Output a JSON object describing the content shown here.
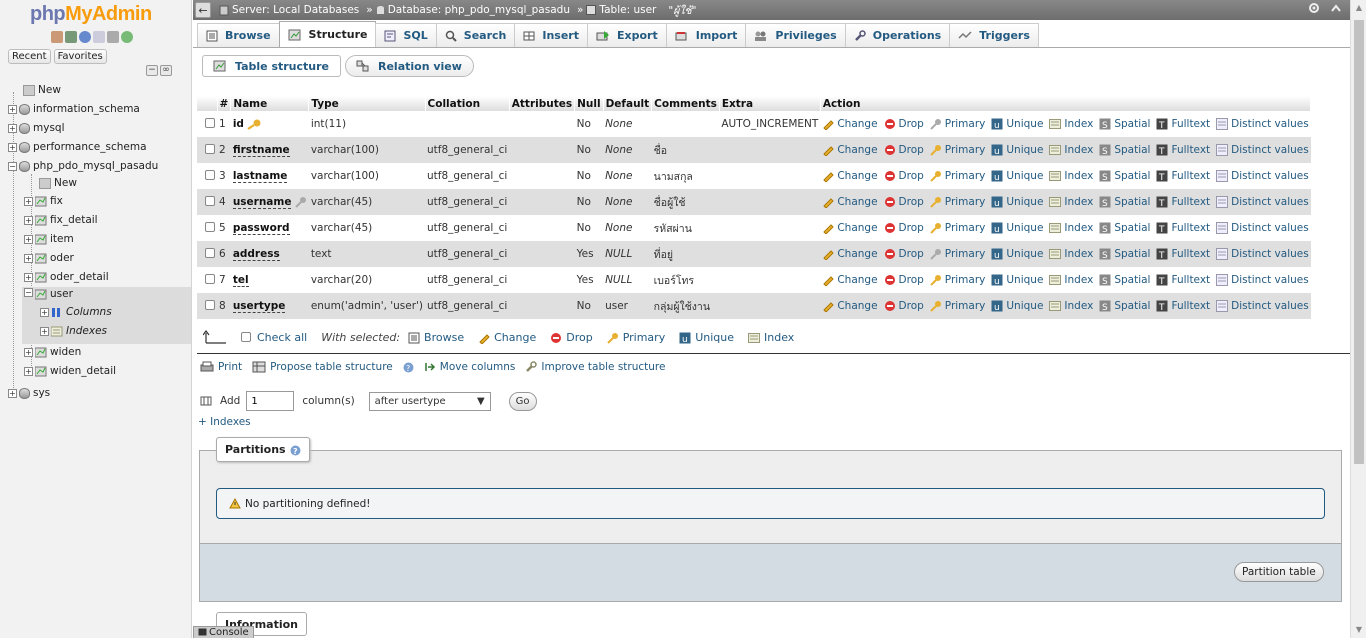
{
  "sidebar": {
    "logo_a": "php",
    "logo_b": "MyAdmin",
    "tabs": [
      "Recent",
      "Favorites"
    ],
    "tree": {
      "new": "New",
      "dbs": [
        {
          "label": "information_schema"
        },
        {
          "label": "mysql"
        },
        {
          "label": "performance_schema"
        },
        {
          "label": "php_pdo_mysql_pasadu"
        },
        {
          "label": "sys"
        }
      ],
      "db_new": "New",
      "tables": [
        "fix",
        "fix_detail",
        "item",
        "oder",
        "oder_detail",
        "user",
        "widen",
        "widen_detail"
      ],
      "user_children": [
        "Columns",
        "Indexes"
      ]
    }
  },
  "topbar": {
    "server": "Server: Local Databases",
    "database": "Database: php_pdo_mysql_pasadu",
    "table": "Table: user",
    "comment": "\"ผู้ใช้\""
  },
  "menu": [
    "Browse",
    "Structure",
    "SQL",
    "Search",
    "Insert",
    "Export",
    "Import",
    "Privileges",
    "Operations",
    "Triggers"
  ],
  "subtabs": [
    "Table structure",
    "Relation view"
  ],
  "table": {
    "headers": [
      "#",
      "Name",
      "Type",
      "Collation",
      "Attributes",
      "Null",
      "Default",
      "Comments",
      "Extra",
      "Action"
    ],
    "rows": [
      {
        "n": "1",
        "name": "id",
        "type": "int(11)",
        "coll": "",
        "attr": "",
        "null": "No",
        "def": "None",
        "com": "",
        "extra": "AUTO_INCREMENT"
      },
      {
        "n": "2",
        "name": "firstname",
        "type": "varchar(100)",
        "coll": "utf8_general_ci",
        "attr": "",
        "null": "No",
        "def": "None",
        "com": "ชื่อ",
        "extra": ""
      },
      {
        "n": "3",
        "name": "lastname",
        "type": "varchar(100)",
        "coll": "utf8_general_ci",
        "attr": "",
        "null": "No",
        "def": "None",
        "com": "นามสกุล",
        "extra": ""
      },
      {
        "n": "4",
        "name": "username",
        "type": "varchar(45)",
        "coll": "utf8_general_ci",
        "attr": "",
        "null": "No",
        "def": "None",
        "com": "ชื่อผู้ใช้",
        "extra": ""
      },
      {
        "n": "5",
        "name": "password",
        "type": "varchar(45)",
        "coll": "utf8_general_ci",
        "attr": "",
        "null": "No",
        "def": "None",
        "com": "รหัสผ่าน",
        "extra": ""
      },
      {
        "n": "6",
        "name": "address",
        "type": "text",
        "coll": "utf8_general_ci",
        "attr": "",
        "null": "Yes",
        "def": "NULL",
        "com": "ที่อยู่",
        "extra": ""
      },
      {
        "n": "7",
        "name": "tel",
        "type": "varchar(20)",
        "coll": "utf8_general_ci",
        "attr": "",
        "null": "Yes",
        "def": "NULL",
        "com": "เบอร์โทร",
        "extra": ""
      },
      {
        "n": "8",
        "name": "usertype",
        "type": "enum('admin', 'user')",
        "coll": "utf8_general_ci",
        "attr": "",
        "null": "No",
        "def": "user",
        "com": "กลุ่มผู้ใช้งาน",
        "extra": ""
      }
    ],
    "actions": [
      "Change",
      "Drop",
      "Primary",
      "Unique",
      "Index",
      "Spatial",
      "Fulltext",
      "Distinct values"
    ]
  },
  "with_selected": {
    "check_all": "Check all",
    "label": "With selected:",
    "actions": [
      "Browse",
      "Change",
      "Drop",
      "Primary",
      "Unique",
      "Index"
    ]
  },
  "tools": [
    "Print",
    "Propose table structure",
    "Move columns",
    "Improve table structure"
  ],
  "add_cols": {
    "label": "Add",
    "value": "1",
    "suffix": "column(s)",
    "position": "after usertype",
    "go": "Go"
  },
  "indexes_link": "+ Indexes",
  "partitions": {
    "legend": "Partitions",
    "notice": "No partitioning defined!",
    "button": "Partition table"
  },
  "information_legend": "Information",
  "console": "Console"
}
